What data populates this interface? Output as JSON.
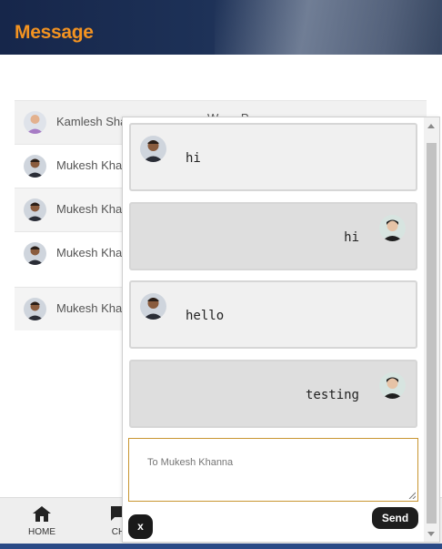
{
  "header": {
    "title": "Message"
  },
  "threads": [
    {
      "name": "Kamlesh Sha",
      "extra": "W...... P......",
      "avatar": "person-icon"
    },
    {
      "name": "Mukesh Kha",
      "avatar": "person-icon"
    },
    {
      "name": "Mukesh Kha",
      "avatar": "person-icon"
    },
    {
      "name": "Mukesh Kha",
      "avatar": "person-icon"
    },
    {
      "name": "Mukesh Kha",
      "avatar": "person-icon"
    }
  ],
  "footer": {
    "tabs": [
      {
        "label": "HOME",
        "icon": "home-icon"
      },
      {
        "label": "CH",
        "icon": "chat-icon"
      }
    ]
  },
  "chat": {
    "messages": [
      {
        "direction": "in",
        "text": "hi"
      },
      {
        "direction": "out",
        "text": "hi"
      },
      {
        "direction": "in",
        "text": "hello"
      },
      {
        "direction": "out",
        "text": "testing"
      }
    ],
    "compose_placeholder": "To Mukesh Khanna",
    "send_label": "Send",
    "close_label": "x"
  },
  "colors": {
    "accent": "#f39321",
    "header_bg": "#1d3157",
    "button_bg": "#1e1e1e",
    "compose_border": "#c89530"
  }
}
